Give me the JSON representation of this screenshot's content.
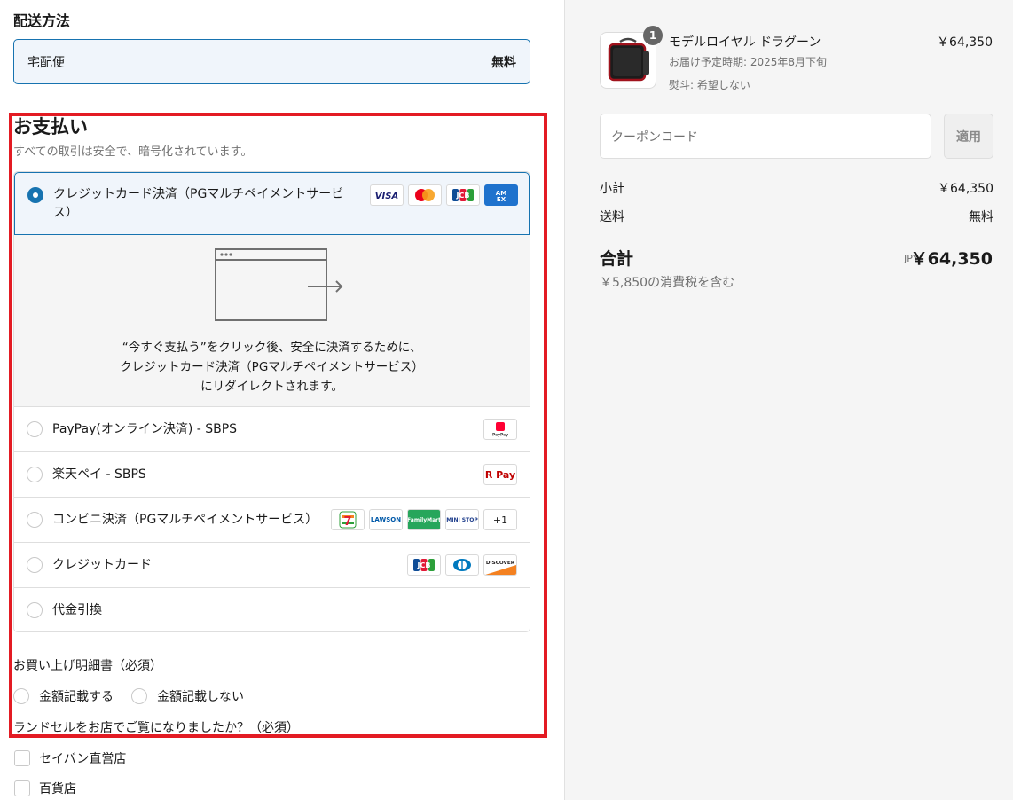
{
  "shipping": {
    "title": "配送方法",
    "method": "宅配便",
    "price": "無料"
  },
  "payment": {
    "title": "お支払い",
    "subtitle": "すべての取引は安全で、暗号化されています。",
    "selected": {
      "label_line1": "クレジットカード決済（PGマルチペイメントサービ",
      "label_line2": "ス）",
      "badges": [
        "VISA",
        "Mastercard",
        "JCB",
        "AMEX"
      ]
    },
    "redirect_text": [
      "“今すぐ支払う”をクリック後、安全に決済するために、",
      "クレジットカード決済（PGマルチペイメントサービス）",
      "にリダイレクトされます。"
    ],
    "options": [
      {
        "label": "PayPay(オンライン決済) - SBPS",
        "badges": [
          "PayPay"
        ]
      },
      {
        "label": "楽天ペイ - SBPS",
        "badges": [
          "R Pay"
        ]
      },
      {
        "label": "コンビニ決済（PGマルチペイメントサービス）",
        "badges": [
          "7-Eleven",
          "LAWSON",
          "FamilyMart",
          "MINI STOP",
          "+1"
        ]
      },
      {
        "label": "クレジットカード",
        "badges": [
          "JCB",
          "Diners",
          "DISCOVER"
        ]
      },
      {
        "label": "代金引換",
        "badges": []
      }
    ]
  },
  "receipt": {
    "label": "お買い上げ明細書（必須）",
    "opt1": "金額記載する",
    "opt2": "金額記載しない"
  },
  "store_question": {
    "label": "ランドセルをお店でご覧になりましたか？（必須）",
    "opt1": "セイバン直営店",
    "opt2": "百貨店"
  },
  "summary": {
    "product": {
      "qty": "1",
      "name": "モデルロイヤル ドラグーン",
      "delivery": "お届け予定時期: 2025年8月下旬",
      "noshi": "熨斗: 希望しない",
      "price": "￥64,350"
    },
    "coupon_placeholder": "クーポンコード",
    "apply_label": "適用",
    "subtotal_label": "小計",
    "subtotal": "￥64,350",
    "shipping_label": "送料",
    "shipping": "無料",
    "total_label": "合計",
    "currency": "JPY",
    "total": "￥64,350",
    "tax_note": "￥5,850の消費税を含む"
  },
  "colors": {
    "accent": "#1773b0",
    "highlight": "#e31b23"
  }
}
